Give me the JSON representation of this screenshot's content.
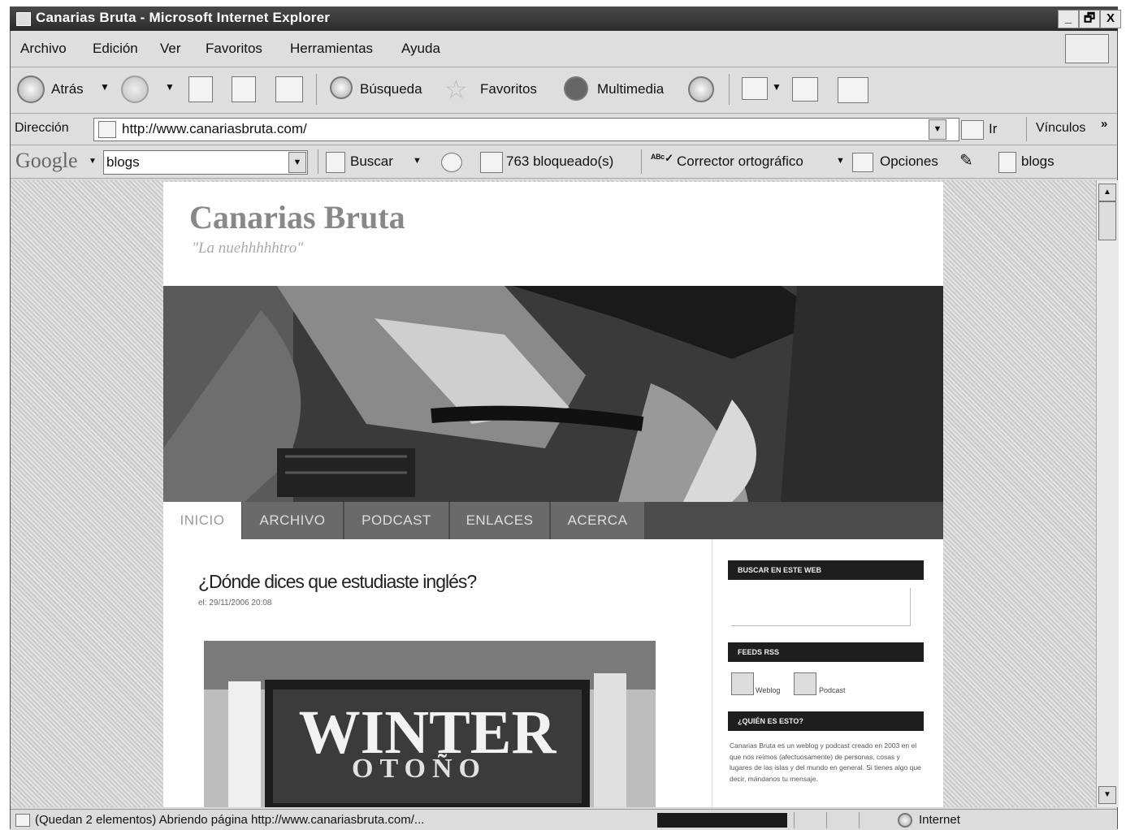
{
  "window": {
    "title": "Canarias Bruta - Microsoft Internet Explorer",
    "controls": [
      "_",
      "🗗",
      "X"
    ]
  },
  "menubar": [
    "Archivo",
    "Edición",
    "Ver",
    "Favoritos",
    "Herramientas",
    "Ayuda"
  ],
  "toolbar": {
    "back": "Atrás",
    "search": "Búsqueda",
    "favorites": "Favoritos",
    "media": "Multimedia"
  },
  "address": {
    "label": "Dirección",
    "url": "http://www.canariasbruta.com/",
    "go": "Ir",
    "links": "Vínculos"
  },
  "google": {
    "logo": "Google",
    "query": "blogs",
    "search": "Buscar",
    "blocked": "763 bloqueado(s)",
    "spell": "Corrector ortográfico",
    "options": "Opciones",
    "highlight": "blogs"
  },
  "blog": {
    "title": "Canarias Bruta",
    "tagline": "\"La nuehhhhhtro\"",
    "nav": [
      "INICIO",
      "ARCHIVO",
      "PODCAST",
      "ENLACES",
      "ACERCA"
    ],
    "post_title": "¿Dónde dices que estudiaste inglés?",
    "post_meta": "el: 29/11/2006 20:08",
    "image_text_1": "WINTER",
    "image_text_2": "OTOÑO"
  },
  "sidebar": {
    "search_heading": "BUSCAR EN ESTE WEB",
    "feeds_heading": "FEEDS RSS",
    "feed_weblog": "Weblog",
    "feed_podcast": "Podcast",
    "about_heading": "¿QUIÉN ES ESTO?",
    "about_text": "Canarias Bruta es un weblog y podcast creado en 2003 en el que nos reímos (afectuosamente) de personas, cosas y lugares de las islas y del mundo en general. Si tienes algo que decir, mándanos tu mensaje."
  },
  "statusbar": {
    "text": "(Quedan 2 elementos) Abriendo página http://www.canariasbruta.com/...",
    "zone": "Internet"
  }
}
